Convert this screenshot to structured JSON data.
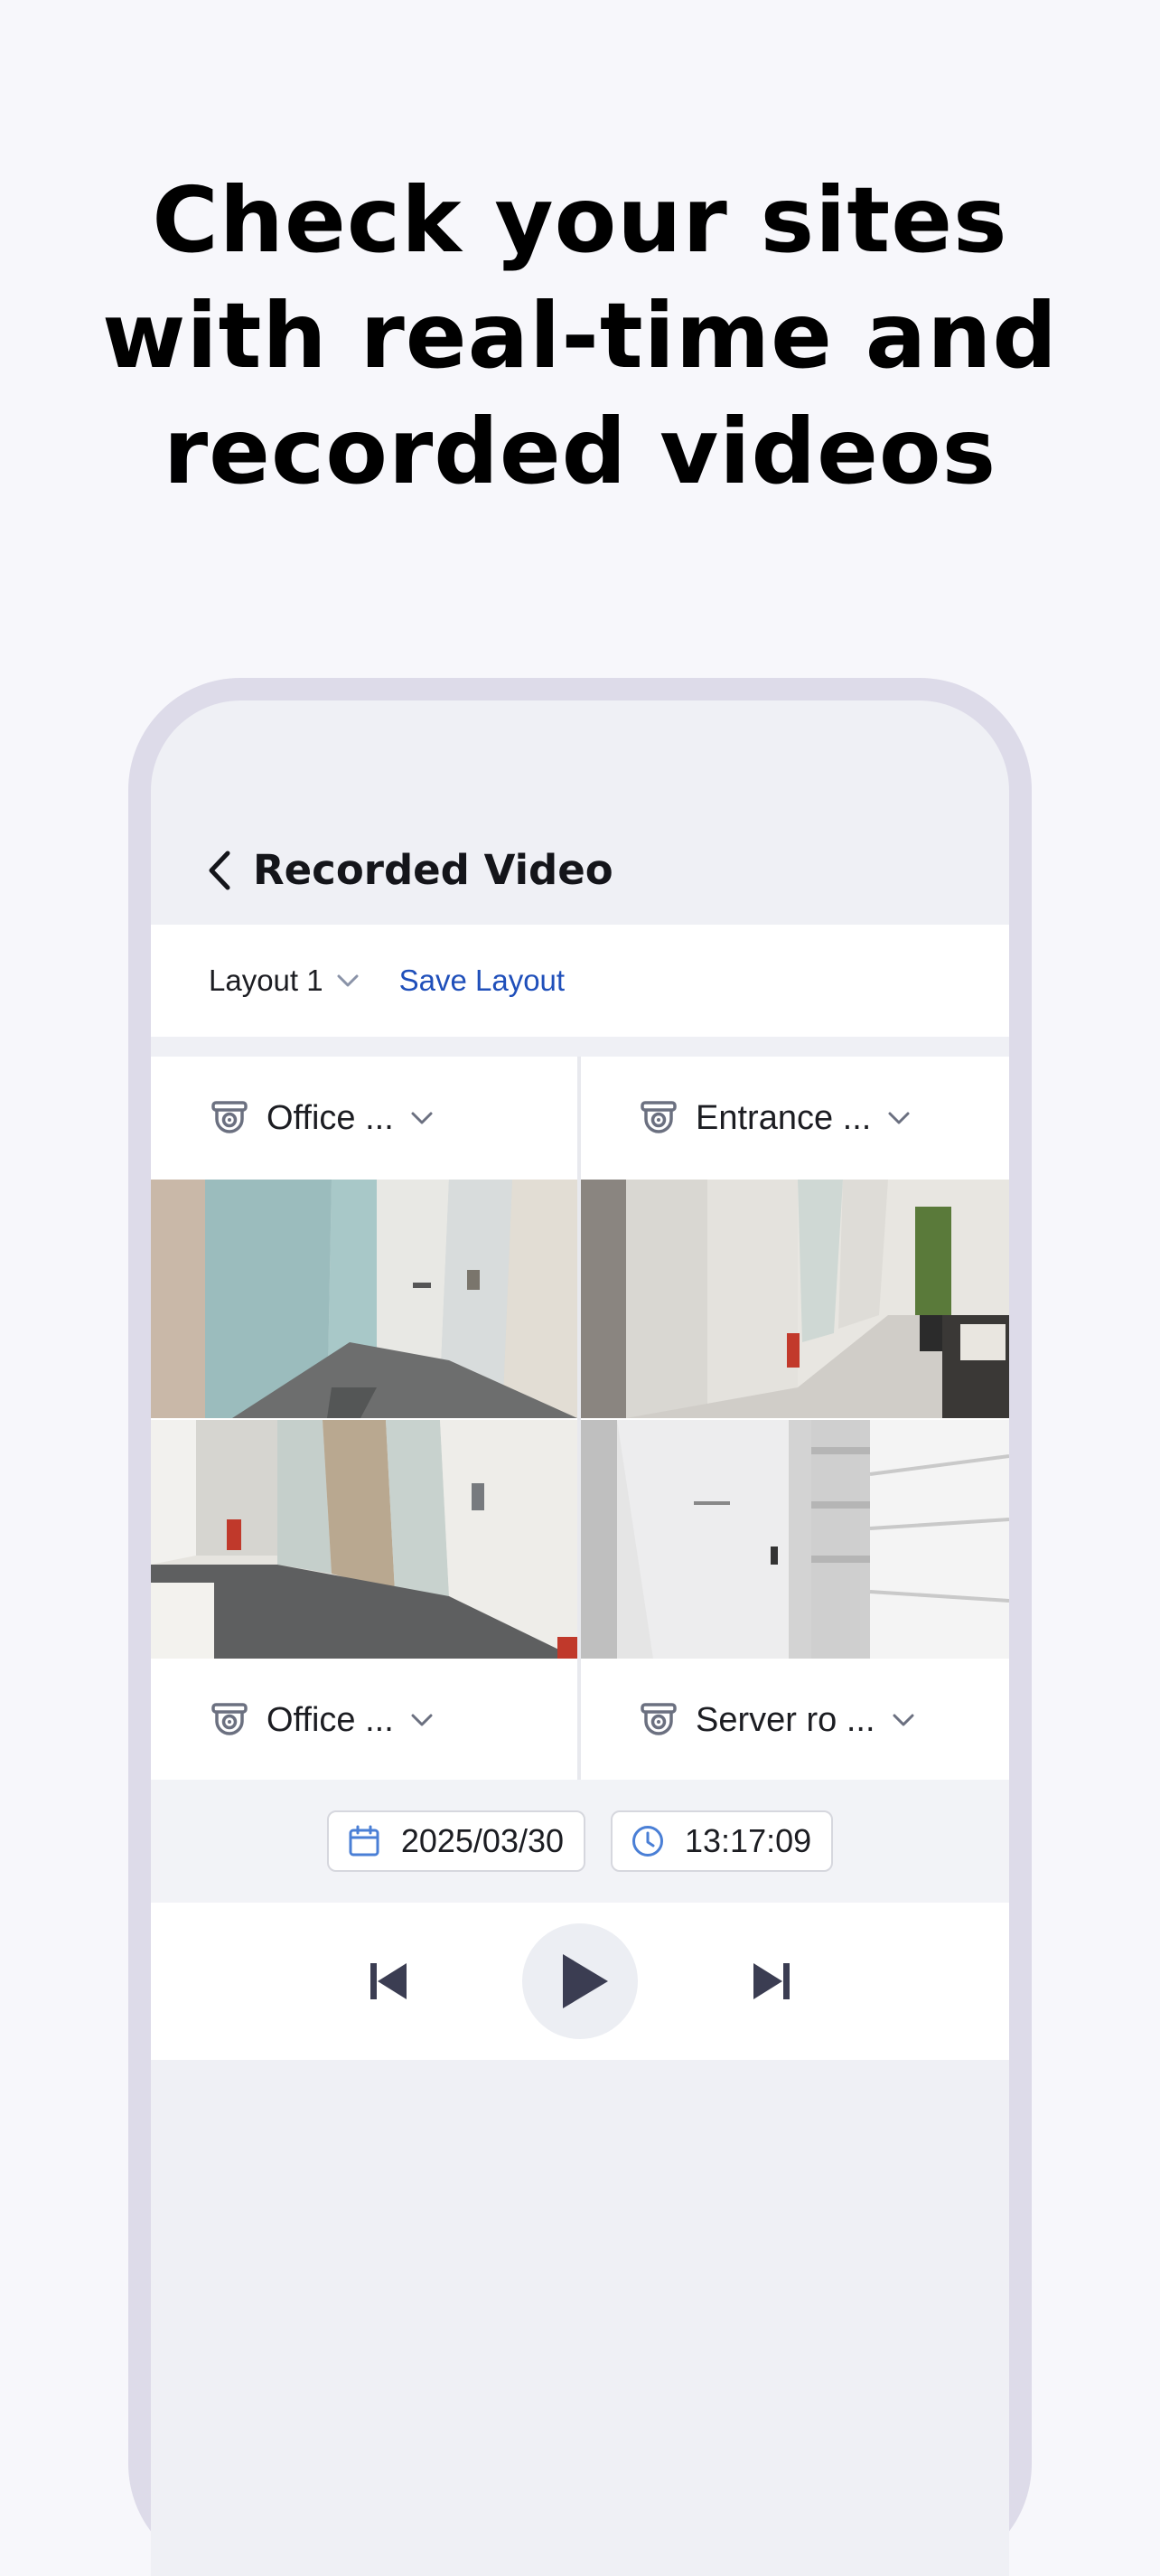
{
  "headline": {
    "line1": "Check your sites",
    "line2": "with real-time and",
    "line3": "recorded videos"
  },
  "header": {
    "title": "Recorded Video",
    "back_icon": "chevron-left-icon"
  },
  "layout_bar": {
    "layout_label": "Layout 1",
    "save_label": "Save Layout"
  },
  "cameras": [
    {
      "name": "Office ...",
      "icon": "cctv-camera-icon"
    },
    {
      "name": "Entrance ...",
      "icon": "cctv-camera-icon"
    },
    {
      "name": "Office ...",
      "icon": "cctv-camera-icon"
    },
    {
      "name": "Server ro ...",
      "icon": "cctv-camera-icon"
    }
  ],
  "datetime": {
    "date": "2025/03/30",
    "time": "13:17:09",
    "date_icon": "calendar-icon",
    "time_icon": "clock-icon"
  },
  "playback": {
    "prev_icon": "skip-previous-icon",
    "play_icon": "play-icon",
    "next_icon": "skip-next-icon"
  },
  "colors": {
    "accent": "#1f4fba",
    "icon_blue": "#4a7fd6",
    "headline": "#000000",
    "control": "#3b3d52"
  }
}
